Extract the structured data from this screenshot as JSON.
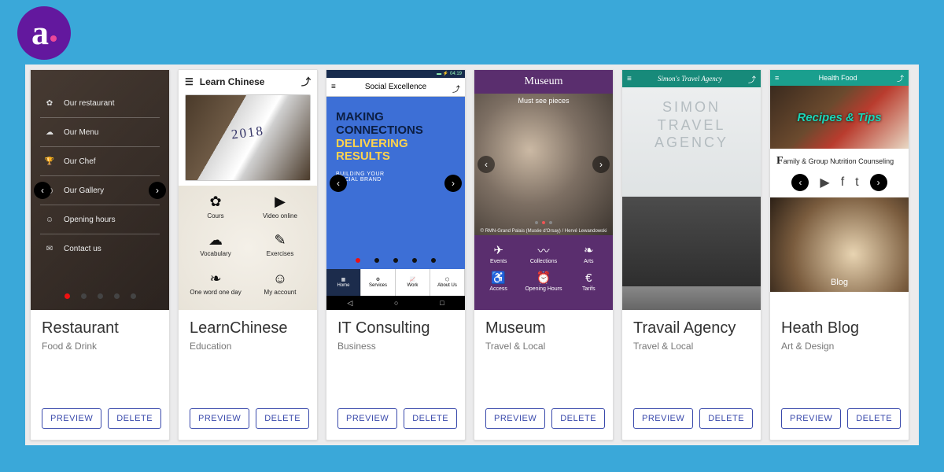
{
  "brand": {
    "letter": "a"
  },
  "buttons": {
    "preview": "PREVIEW",
    "delete": "DELETE"
  },
  "cards": [
    {
      "title": "Restaurant",
      "category": "Food & Drink",
      "menu": [
        "Our restaurant",
        "Our Menu",
        "Our Chef",
        "Our Gallery",
        "Opening hours",
        "Contact us"
      ]
    },
    {
      "title": "LearnChinese",
      "category": "Education",
      "header": "Learn Chinese",
      "grid": [
        "Cours",
        "Video online",
        "Vocabulary",
        "Exercises",
        "One word one day",
        "My account"
      ]
    },
    {
      "title": "IT Consulting",
      "category": "Business",
      "app_title": "Social Excellence",
      "headline1": "MAKING",
      "headline2": "CONNECTIONS",
      "headline3": "DELIVERING",
      "headline4": "RESULTS",
      "sub1": "BUILDING YOUR",
      "sub2": "SOCIAL BRAND",
      "tabs": [
        "Home",
        "Services",
        "Work",
        "About Us"
      ]
    },
    {
      "title": "Museum",
      "category": "Travel & Local",
      "header": "Museum",
      "subtitle": "Must see pieces",
      "credit": "© RMN-Grand Palais (Musée d'Orsay) / Hervé Lewandowski",
      "icons": [
        "Events",
        "Collections",
        "Arts",
        "Access",
        "Opening Hours",
        "Tarifs"
      ]
    },
    {
      "title": "Travail Agency",
      "category": "Travel & Local",
      "brand": "Simon's Travel Agency",
      "overlay1": "SIMON",
      "overlay2": "TRAVEL",
      "overlay3": "AGENCY"
    },
    {
      "title": "Heath Blog",
      "category": "Art & Design",
      "bar": "Health Food",
      "hero": "Recipes & Tips",
      "line_prefix": "F",
      "line": "amily & Group Nutrition Counseling",
      "blog": "Blog"
    }
  ]
}
